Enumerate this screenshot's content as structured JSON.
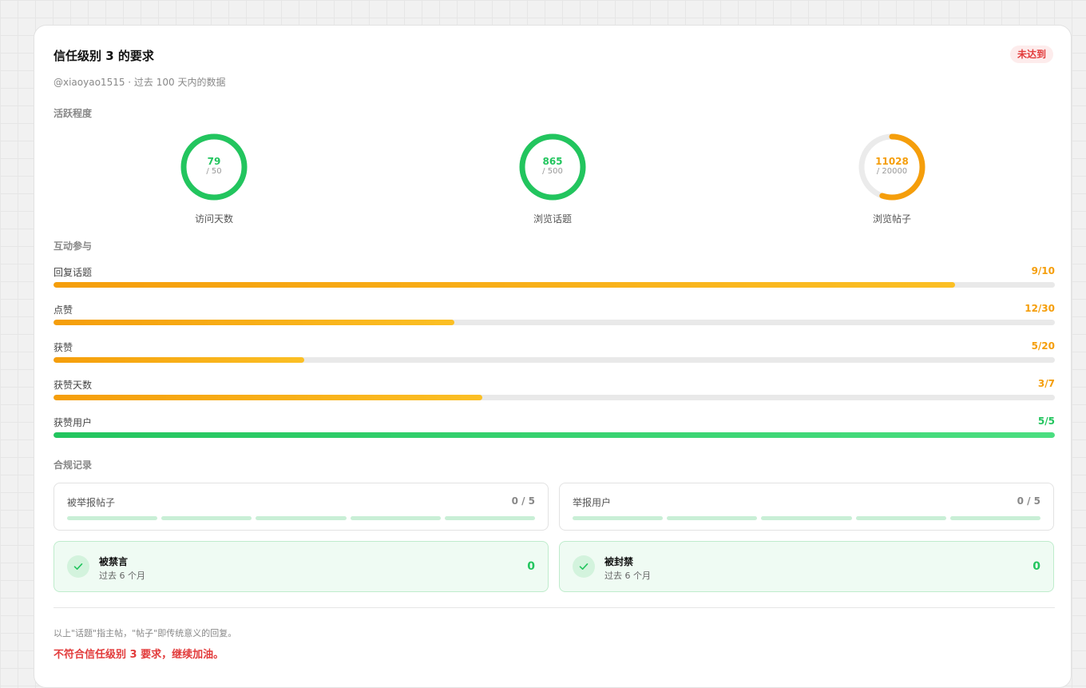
{
  "header": {
    "title": "信任级别 3 的要求",
    "status_badge": "未达到",
    "subtitle": "@xiaoyao1515 · 过去 100 天内的数据"
  },
  "sections": {
    "activity": "活跃程度",
    "interaction": "互动参与",
    "compliance": "合规记录"
  },
  "activity": [
    {
      "label": "访问天数",
      "value": "79",
      "target": "/ 50",
      "fraction": 1.0,
      "met": true
    },
    {
      "label": "浏览话题",
      "value": "865",
      "target": "/ 500",
      "fraction": 1.0,
      "met": true
    },
    {
      "label": "浏览帖子",
      "value": "11028",
      "target": "/ 20000",
      "fraction": 0.5514,
      "met": false
    }
  ],
  "interaction": [
    {
      "label": "回复话题",
      "value": "9/10",
      "fraction": 0.9,
      "met": false
    },
    {
      "label": "点赞",
      "value": "12/30",
      "fraction": 0.4,
      "met": false
    },
    {
      "label": "获赞",
      "value": "5/20",
      "fraction": 0.25,
      "met": false
    },
    {
      "label": "获赞天数",
      "value": "3/7",
      "fraction": 0.4286,
      "met": false
    },
    {
      "label": "获赞用户",
      "value": "5/5",
      "fraction": 1.0,
      "met": true
    }
  ],
  "compliance": {
    "reports": [
      {
        "label": "被举报帖子",
        "value": "0 / 5"
      },
      {
        "label": "举报用户",
        "value": "0 / 5"
      }
    ],
    "penalties": [
      {
        "title": "被禁言",
        "subtitle": "过去 6 个月",
        "value": "0"
      },
      {
        "title": "被封禁",
        "subtitle": "过去 6 个月",
        "value": "0"
      }
    ]
  },
  "footer": {
    "note": "以上\"话题\"指主帖，\"帖子\"即传统意义的回复。",
    "verdict": "不符合信任级别 3 要求，继续加油。"
  },
  "colors": {
    "success": "#22c55e",
    "warning": "#f59e0b",
    "danger": "#e23b3b",
    "track": "#ebebeb"
  },
  "icons": {
    "penalty_status": "check-icon"
  }
}
